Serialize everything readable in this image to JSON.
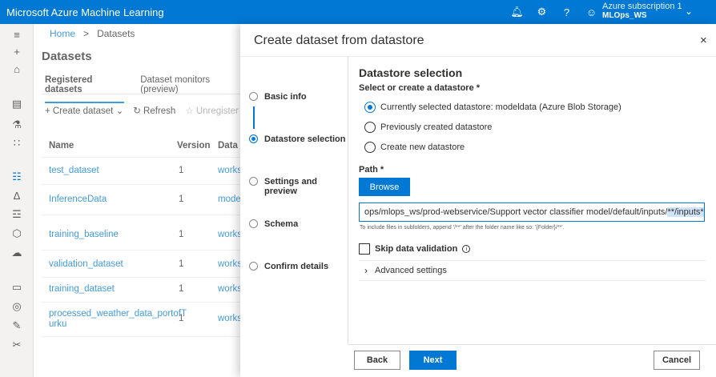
{
  "app": {
    "title": "Microsoft Azure Machine Learning",
    "subscription": "Azure subscription 1",
    "workspace": "MLOps_WS"
  },
  "topbar_icons": [
    "bell-icon",
    "gear-icon",
    "help-icon",
    "smiley-icon"
  ],
  "rail_icons": [
    "hamburger-icon",
    "plus-icon",
    "home-icon",
    "notebook-icon",
    "automl-icon",
    "designer-icon",
    "datasets-icon",
    "experiments-icon",
    "pipelines-icon",
    "models-icon",
    "endpoints-icon",
    "compute-icon",
    "datastores-icon",
    "labeling-icon",
    "linked-services-icon"
  ],
  "breadcrumb": {
    "home": "Home",
    "sep": ">",
    "current": "Datasets"
  },
  "page": {
    "title": "Datasets",
    "tabs": [
      "Registered datasets",
      "Dataset monitors (preview)"
    ],
    "commands": {
      "create": "Create dataset",
      "refresh": "Refresh",
      "unregister": "Unregister"
    },
    "columns": [
      "Name",
      "Version",
      "Data"
    ],
    "rows": [
      {
        "name": "test_dataset",
        "version": "1",
        "data": "works"
      },
      {
        "name": "InferenceData",
        "version": "1",
        "data": "mode"
      },
      {
        "name": "training_baseline",
        "version": "1",
        "data": "works"
      },
      {
        "name": "validation_dataset",
        "version": "1",
        "data": "works"
      },
      {
        "name": "training_dataset",
        "version": "1",
        "data": "works"
      },
      {
        "name": "processed_weather_data_portofT urku",
        "version": "1",
        "data": "works"
      }
    ]
  },
  "panel": {
    "title": "Create dataset from datastore",
    "close": "×",
    "steps": [
      "Basic info",
      "Datastore selection",
      "Settings and preview",
      "Schema",
      "Confirm details"
    ],
    "current_step": 1,
    "section_title": "Datastore selection",
    "select_label": "Select or create a datastore *",
    "options": [
      "Currently selected datastore: modeldata (Azure Blob Storage)",
      "Previously created datastore",
      "Create new datastore"
    ],
    "selected_option": 0,
    "path_label": "Path *",
    "browse": "Browse",
    "path_value_prefix": "ops/mlops_ws/prod-webservice/Support vector classifier model/default/inputs/",
    "path_value_selected": "**/inputs*.csv",
    "hint": "To include files in subfolders, append '/**' after the folder name like so: '{Folder}/**'.",
    "skip_validation": "Skip data validation",
    "advanced": "Advanced settings",
    "back": "Back",
    "next": "Next",
    "cancel": "Cancel"
  }
}
